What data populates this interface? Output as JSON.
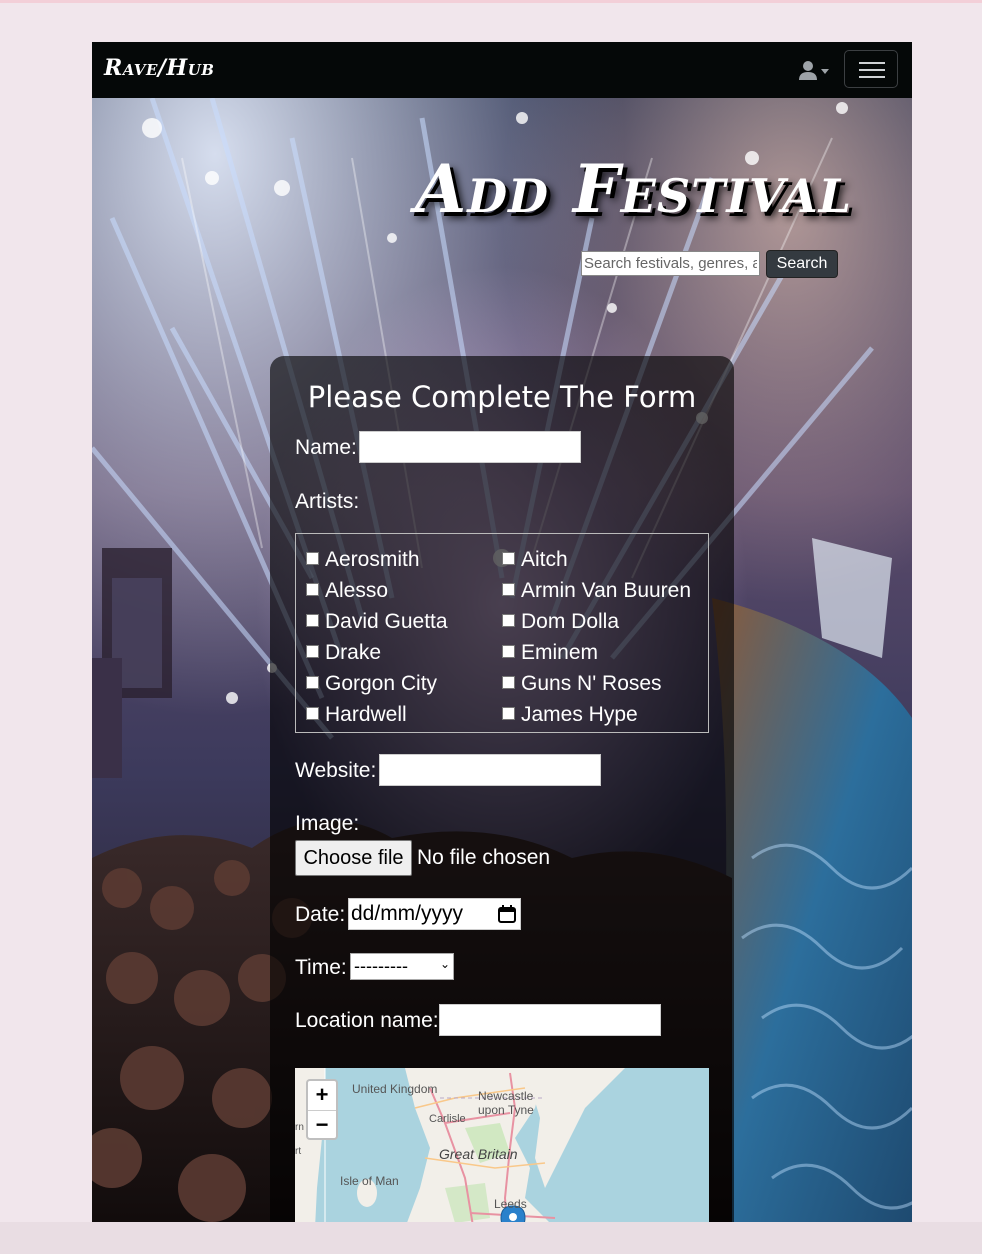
{
  "navbar": {
    "brand": "Rave/Hub",
    "user_menu_icon": "user-icon",
    "menu_icon": "hamburger-icon"
  },
  "header": {
    "title": "Add Festival",
    "search_placeholder": "Search festivals, genres, artists",
    "search_button": "Search"
  },
  "form": {
    "heading": "Please Complete The Form",
    "name_label": "Name:",
    "artists_label": "Artists:",
    "artists": [
      "Aerosmith",
      "Aitch",
      "Alesso",
      "Armin Van Buuren",
      "David Guetta",
      "Dom Dolla",
      "Drake",
      "Eminem",
      "Gorgon City",
      "Guns N' Roses",
      "Hardwell",
      "James Hype"
    ],
    "website_label": "Website:",
    "image_label": "Image:",
    "file_button": "Choose file",
    "file_status": "No file chosen",
    "date_label": "Date:",
    "date_placeholder": "dd/mm/yyyy",
    "time_label": "Time:",
    "time_value": "---------",
    "location_label": "Location name:"
  },
  "map": {
    "zoom_in": "+",
    "zoom_out": "−",
    "labels": {
      "uk": "United Kingdom",
      "newcastle": "Newcastle upon Tyne",
      "carlisle": "Carlisle",
      "gb": "Great Britain",
      "iom": "Isle of Man",
      "leeds": "Leeds",
      "edge1": "rn",
      "edge2": "rt"
    }
  },
  "colors": {
    "navbar_bg": "#050808",
    "search_button_bg": "#343a40",
    "card_bg": "rgba(0,0,0,0.62)",
    "map_water": "#aad3df"
  }
}
